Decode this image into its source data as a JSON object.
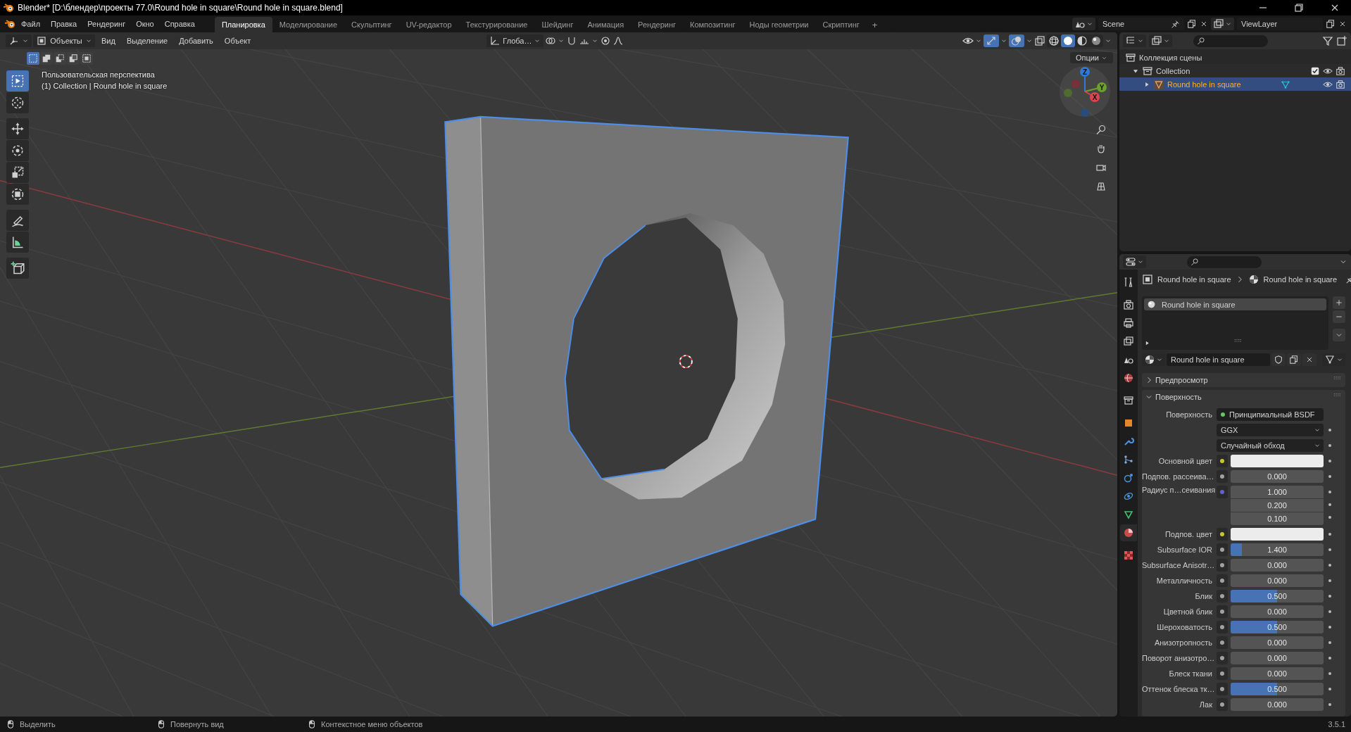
{
  "window": {
    "title": "Blender* [D:\\блендер\\проекты 77.0\\Round hole in square\\Round hole in square.blend]"
  },
  "menu": [
    "Файл",
    "Правка",
    "Рендеринг",
    "Окно",
    "Справка"
  ],
  "workspaces": [
    {
      "label": "Планировка",
      "selected": true
    },
    {
      "label": "Моделирование",
      "selected": false
    },
    {
      "label": "Скульптинг",
      "selected": false
    },
    {
      "label": "UV-редактор",
      "selected": false
    },
    {
      "label": "Текстурирование",
      "selected": false
    },
    {
      "label": "Шейдинг",
      "selected": false
    },
    {
      "label": "Анимация",
      "selected": false
    },
    {
      "label": "Рендеринг",
      "selected": false
    },
    {
      "label": "Композитинг",
      "selected": false
    },
    {
      "label": "Ноды геометрии",
      "selected": false
    },
    {
      "label": "Скриптинг",
      "selected": false
    }
  ],
  "add_workspace": "+",
  "scene": "Scene",
  "view_layer": "ViewLayer",
  "viewport": {
    "mode": "Объекты",
    "menu": [
      "Вид",
      "Выделение",
      "Добавить",
      "Объект"
    ],
    "orientation": "Глоба…",
    "show_gizmos": true,
    "show_overlays": true,
    "shading": [
      {
        "kind": "wireframe",
        "selected": false
      },
      {
        "kind": "solid",
        "selected": true
      },
      {
        "kind": "material",
        "selected": false
      },
      {
        "kind": "rendered",
        "selected": false
      }
    ],
    "options": "Опции",
    "select_modes": [
      {
        "kind": "new",
        "selected": true
      },
      {
        "kind": "extend",
        "selected": false
      },
      {
        "kind": "subtract",
        "selected": false
      },
      {
        "kind": "difference",
        "selected": false
      },
      {
        "kind": "intersect",
        "selected": false
      }
    ],
    "tools": [
      {
        "kind": "select-box",
        "selected": true
      },
      {
        "kind": "cursor",
        "selected": false
      },
      {
        "kind": "move",
        "selected": false
      },
      {
        "kind": "rotate",
        "selected": false
      },
      {
        "kind": "scale",
        "selected": false
      },
      {
        "kind": "transform",
        "selected": false
      },
      {
        "kind": "annotate",
        "selected": false
      },
      {
        "kind": "measure",
        "selected": false
      },
      {
        "kind": "add-cube",
        "selected": false
      }
    ],
    "view_name": "Пользовательская перспектива",
    "object_info": "(1) Collection | Round hole in square",
    "gizmo_axes": [
      {
        "label": "Z",
        "color": "#2f7ad6"
      },
      {
        "label": "Y",
        "color": "#6ba22b"
      },
      {
        "label": "X",
        "color": "#e0424f"
      }
    ]
  },
  "outliner": {
    "root": "Коллекция сцены",
    "items": [
      {
        "name": "Collection",
        "expanded": true,
        "checked": true,
        "selected": false,
        "children": [
          {
            "name": "Round hole in square",
            "expanded": false,
            "selected": true
          }
        ]
      }
    ]
  },
  "properties": {
    "tabs": [
      {
        "kind": "tool",
        "selected": false
      },
      {
        "kind": "render",
        "selected": false
      },
      {
        "kind": "output",
        "selected": false
      },
      {
        "kind": "view-layer",
        "selected": false
      },
      {
        "kind": "scene",
        "selected": false
      },
      {
        "kind": "world",
        "selected": false
      },
      {
        "kind": "collection",
        "selected": false
      },
      {
        "kind": "object",
        "selected": false
      },
      {
        "kind": "modifier",
        "selected": false
      },
      {
        "kind": "particles",
        "selected": false
      },
      {
        "kind": "physics",
        "selected": false
      },
      {
        "kind": "constraints",
        "selected": false
      },
      {
        "kind": "data",
        "selected": false
      },
      {
        "kind": "material",
        "selected": true
      },
      {
        "kind": "texture",
        "selected": false
      }
    ],
    "breadcrumb": [
      "Round hole in square",
      "Round hole in square"
    ],
    "slots": [
      {
        "name": "Round hole in square",
        "selected": true
      }
    ],
    "material": "Round hole in square",
    "panels": [
      {
        "kind": "preview",
        "title": "Предпросмотр",
        "expanded": false
      },
      {
        "kind": "surface",
        "title": "Поверхность",
        "expanded": true
      }
    ],
    "surface_label": "Поверхность",
    "shader": "Принципиальный BSDF",
    "dropdowns": [
      "GGX",
      "Случайный обход"
    ],
    "inputs": [
      {
        "label": "Основной цвет",
        "kind": "color"
      },
      {
        "label": "Подпов. рассеива…",
        "kind": "float",
        "value": "0.000"
      },
      {
        "label": "Радиус п…сеивания",
        "kind": "vector",
        "values": [
          "1.000",
          "0.200",
          "0.100"
        ]
      },
      {
        "label": "Подпов. цвет",
        "kind": "color"
      },
      {
        "label": "Subsurface IOR",
        "kind": "float",
        "value": "1.400",
        "level": 0.12
      },
      {
        "label": "Subsurface Anisotr…",
        "kind": "float",
        "value": "0.000"
      },
      {
        "label": "Металличность",
        "kind": "float",
        "value": "0.000"
      },
      {
        "label": "Блик",
        "kind": "float",
        "value": "0.500",
        "level": 0.5
      },
      {
        "label": "Цветной блик",
        "kind": "float",
        "value": "0.000"
      },
      {
        "label": "Шероховатость",
        "kind": "float",
        "value": "0.500",
        "level": 0.5
      },
      {
        "label": "Анизотропность",
        "kind": "float",
        "value": "0.000"
      },
      {
        "label": "Поворот анизотро…",
        "kind": "float",
        "value": "0.000"
      },
      {
        "label": "Блеск ткани",
        "kind": "float",
        "value": "0.000"
      },
      {
        "label": "Оттенок блеска тк…",
        "kind": "float",
        "value": "0.500",
        "level": 0.5
      },
      {
        "label": "Лак",
        "kind": "float",
        "value": "0.000"
      }
    ]
  },
  "status_bar": {
    "hints": [
      "Выделить",
      "Повернуть вид",
      "Контекстное меню объектов"
    ],
    "version": "3.5.1"
  }
}
